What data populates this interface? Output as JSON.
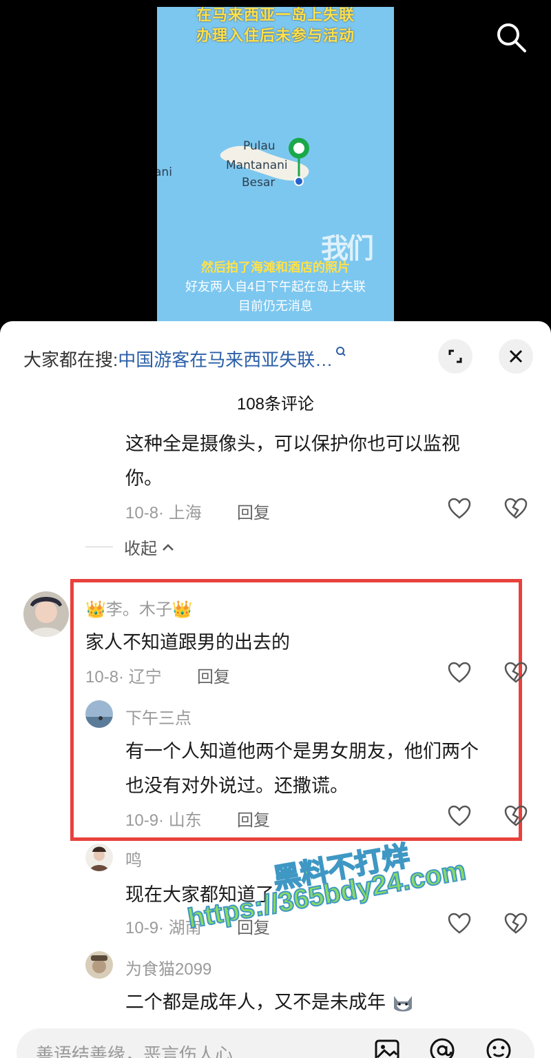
{
  "video": {
    "title_line1": "在马来西亚一岛上失联",
    "title_line2": "办理入住后未参与活动",
    "map_label_1": "Pulau",
    "map_label_2": "Mantanani",
    "map_label_3": "Besar",
    "map_label_4": "ani",
    "logo": "我们",
    "sub1": "然后拍了海滩和酒店的照片",
    "sub2": "好友两人自4日下午起在岛上失联",
    "sub3": "目前仍无消息"
  },
  "header": {
    "hot_search_label": "大家都在搜:",
    "hot_search_link": "中国游客在马来西亚失联…",
    "comment_count": "108条评论"
  },
  "comments": [
    {
      "text_line1": "这种全是摄像头，可以保护你也可以监视",
      "text_line2": "你。",
      "meta": "10-8· 上海",
      "reply": "回复"
    },
    {
      "collapse": "收起"
    },
    {
      "username": "李。木子",
      "text": "家人不知道跟男的出去的",
      "meta": "10-8· 辽宁",
      "reply": "回复"
    },
    {
      "username": "下午三点",
      "text_line1": "有一个人知道他两个是男女朋友，他们两个",
      "text_line2": "也没有对外说过。还撒谎。",
      "meta": "10-9· 山东",
      "reply": "回复"
    },
    {
      "username": "鸣",
      "text": "现在大家都知道了",
      "meta": "10-9· 湖南",
      "reply": "回复"
    },
    {
      "username": "为食猫2099",
      "text": "二个都是成年人，又不是未成年"
    }
  ],
  "watermark": {
    "line1": "黑料不打烊",
    "line2": "https://365bdy24.com"
  },
  "input": {
    "placeholder": "善语结善缘，恶言伤人心"
  },
  "colors": {
    "highlight": "#e8413c",
    "link": "#2a5fa8",
    "map_sea": "#7cc7ef"
  }
}
